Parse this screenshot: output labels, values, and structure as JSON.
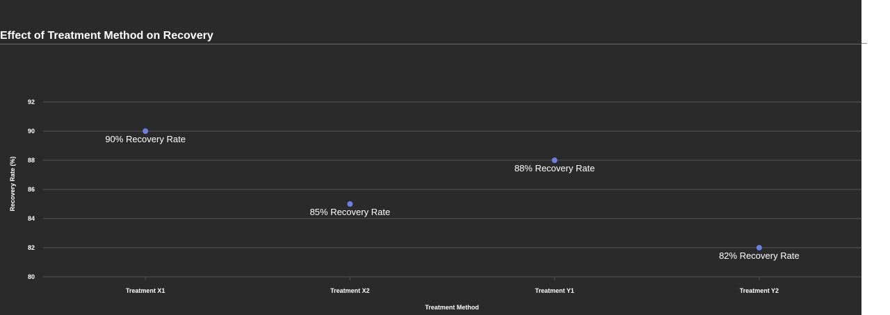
{
  "chart_data": {
    "type": "scatter",
    "title": "Effect of Treatment Method on Recovery",
    "xlabel": "Treatment Method",
    "ylabel": "Recovery Rate (%)",
    "categories": [
      "Treatment X1",
      "Treatment X2",
      "Treatment Y1",
      "Treatment Y2"
    ],
    "series": [
      {
        "values": [
          90,
          85,
          88,
          82
        ],
        "labels": [
          "90% Recovery Rate",
          "85% Recovery Rate",
          "88% Recovery Rate",
          "82% Recovery Rate"
        ]
      }
    ],
    "ylim": [
      80,
      92
    ],
    "yticks": [
      80,
      82,
      84,
      86,
      88,
      90,
      92
    ],
    "grid": true,
    "background": "#2a2a2a",
    "grid_color": "#555555",
    "point_color": "#6b7fe0",
    "text_color": "#ffffff"
  }
}
